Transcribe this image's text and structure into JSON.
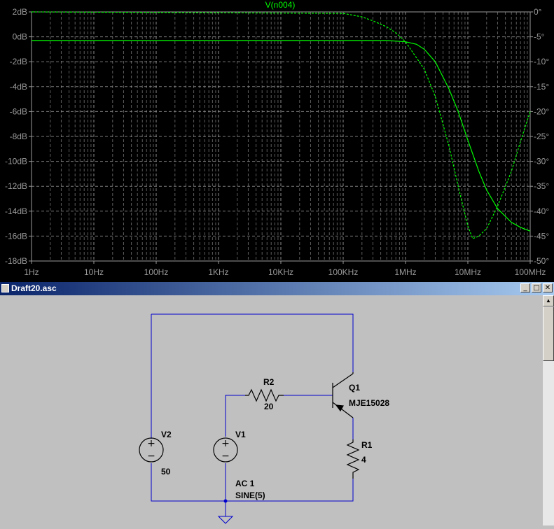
{
  "plot": {
    "trace_label": "V(n004)",
    "left_ticks": [
      "2dB",
      "0dB",
      "-2dB",
      "-4dB",
      "-6dB",
      "-8dB",
      "-10dB",
      "-12dB",
      "-14dB",
      "-16dB",
      "-18dB"
    ],
    "right_ticks": [
      "0°",
      "-5°",
      "-10°",
      "-15°",
      "-20°",
      "-25°",
      "-30°",
      "-35°",
      "-40°",
      "-45°",
      "-50°"
    ],
    "x_ticks": [
      "1Hz",
      "10Hz",
      "100Hz",
      "1KHz",
      "10KHz",
      "100KHz",
      "1MHz",
      "10MHz",
      "100MHz"
    ],
    "colors": {
      "background": "#000000",
      "trace": "#00ff00",
      "grid": "#9a9a9a"
    }
  },
  "chart_data": {
    "type": "line",
    "title": "V(n004)",
    "x_scale": "log",
    "xlim": [
      1,
      100000000
    ],
    "ylim": [
      -18,
      2
    ],
    "y2lim": [
      -50,
      0
    ],
    "grid": true,
    "series": [
      {
        "name": "V(n004)",
        "axis": "left",
        "style": "solid",
        "x": [
          1,
          100000,
          500000,
          1000000,
          1500000,
          2000000,
          3000000,
          5000000,
          7000000,
          10000000,
          15000000,
          20000000,
          30000000,
          50000000,
          70000000,
          100000000
        ],
        "values": [
          -0.3,
          -0.3,
          -0.3,
          -0.4,
          -0.6,
          -1.0,
          -2.0,
          -4.2,
          -6.0,
          -8.3,
          -10.8,
          -12.3,
          -13.8,
          -14.9,
          -15.3,
          -15.6
        ]
      },
      {
        "name": "V(n004) phase",
        "axis": "right",
        "style": "dashed",
        "x": [
          1,
          100000,
          200000,
          300000,
          500000,
          700000,
          1000000,
          2000000,
          3000000,
          5000000,
          7000000,
          10000000,
          12000000,
          15000000,
          20000000,
          30000000,
          50000000,
          70000000,
          100000000
        ],
        "values": [
          0,
          -0.3,
          -1.0,
          -1.8,
          -3.0,
          -4.2,
          -6.0,
          -11.5,
          -17.0,
          -27.0,
          -35.0,
          -43.0,
          -45.5,
          -45.0,
          -43.5,
          -39.0,
          -32.0,
          -26.0,
          -20.0
        ]
      }
    ]
  },
  "window": {
    "title": "Draft20.asc",
    "minimize_glyph": "_",
    "maximize_glyph": "□",
    "close_glyph": "✕",
    "scroll_up_glyph": "▲"
  },
  "schematic": {
    "q1": {
      "name": "Q1",
      "model": "MJE15028"
    },
    "r2": {
      "name": "R2",
      "value": "20"
    },
    "r1": {
      "name": "R1",
      "value": "4"
    },
    "v2": {
      "name": "V2",
      "value": "50"
    },
    "v1": {
      "name": "V1",
      "value1": "AC 1",
      "value2": "SINE(5)"
    },
    "colors": {
      "wire": "#0000cd",
      "background": "#c0c0c0"
    }
  }
}
